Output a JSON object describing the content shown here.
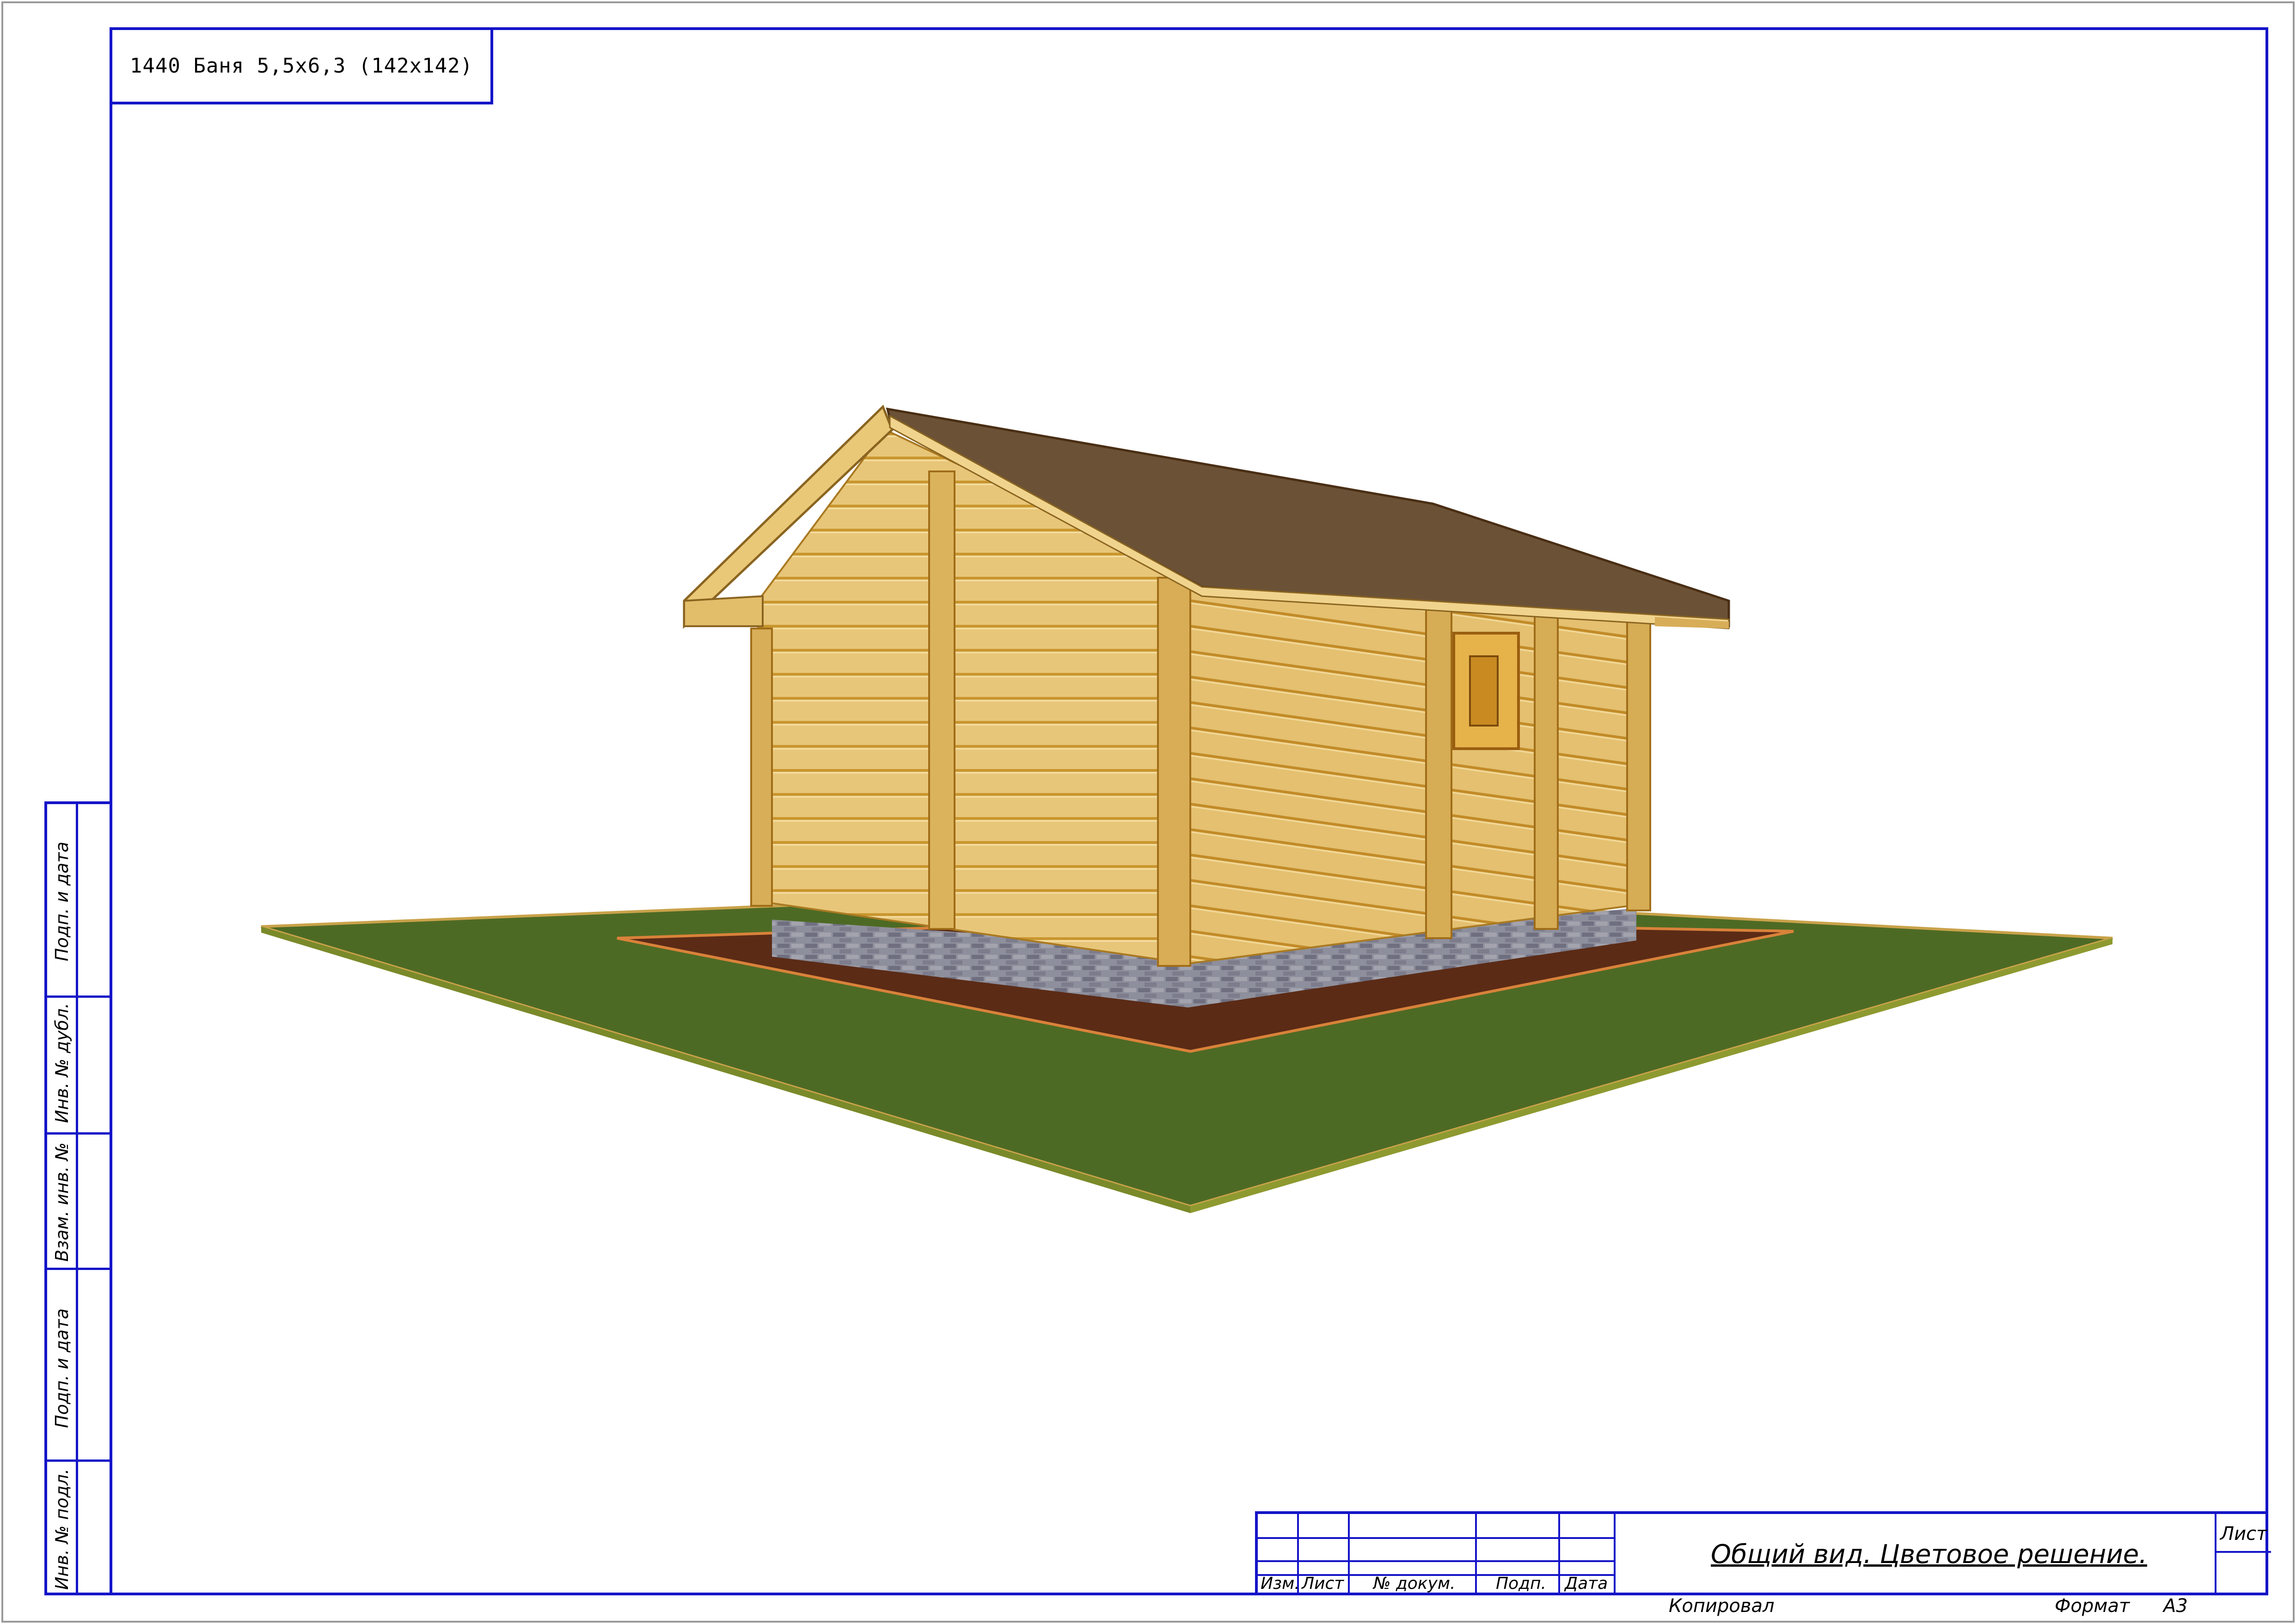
{
  "drawing": {
    "title": "1440 Баня 5,5х6,3 (142х142)"
  },
  "side_strip": {
    "labels": [
      "Подп. и дата",
      "Инв. № дубл.",
      "Взам. инв. №",
      "Подп. и дата",
      "Инв. № подл."
    ]
  },
  "title_block": {
    "columns": [
      "Изм.",
      "Лист",
      "№ докум.",
      "Подп.",
      "Дата"
    ],
    "sheet_title": "Общий вид. Цветовое решение.",
    "sheet_label": "Лист"
  },
  "footer": {
    "copied": "Копировал",
    "format_label": "Формат",
    "format_value": "А3"
  },
  "colors": {
    "frame": "#1414c8",
    "wood": "#e6c070",
    "grass": "#4f6a26",
    "soil": "#5a2a14",
    "roof": "#6b5034",
    "plinth": "#8c8c9a"
  }
}
